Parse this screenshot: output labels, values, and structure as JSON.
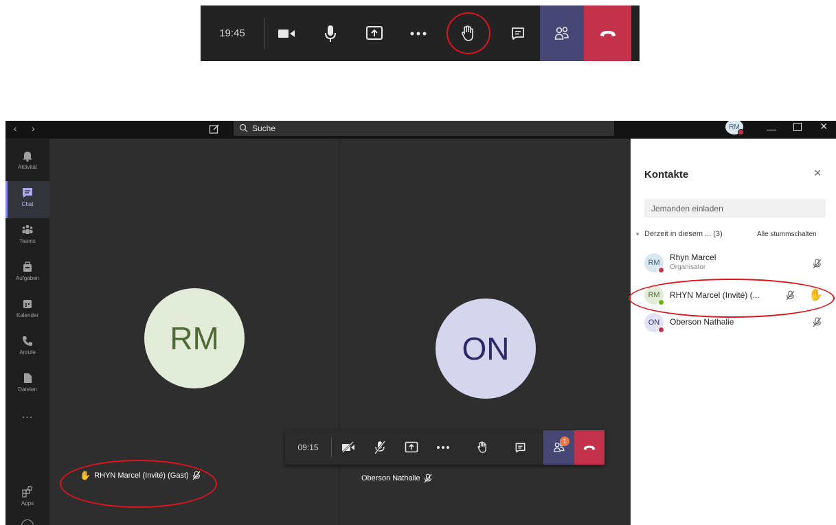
{
  "top_toolbar": {
    "time": "19:45",
    "buttons": [
      "camera-icon",
      "microphone-icon",
      "share-screen-icon",
      "more-options-icon",
      "raise-hand-icon",
      "chat-icon",
      "participants-icon",
      "hang-up-icon"
    ]
  },
  "titlebar": {
    "search_placeholder": "Suche",
    "avatar": "RM"
  },
  "rail": {
    "items": [
      {
        "label": "Aktivität"
      },
      {
        "label": "Chat"
      },
      {
        "label": "Teams"
      },
      {
        "label": "Aufgaben"
      },
      {
        "label": "Kalender"
      },
      {
        "label": "Anrufe"
      },
      {
        "label": "Dateien"
      },
      {
        "label": "Apps"
      }
    ],
    "more": "..."
  },
  "tiles": [
    {
      "initials": "RM",
      "name": "RHYN Marcel (Invité) (Gast)",
      "bg": "#e3ecd9",
      "fg": "#4f6b35"
    },
    {
      "initials": "ON",
      "name": "Oberson Nathalie",
      "bg": "#d6d5ee",
      "fg": "#2b2a66"
    }
  ],
  "meeting_toolbar": {
    "time": "09:15",
    "participants_badge": "1"
  },
  "panel": {
    "title": "Kontakte",
    "invite_placeholder": "Jemanden einladen",
    "section_label": "Derzeit in diesem ... (3)",
    "mute_all": "Alle stummschalten",
    "participants": [
      {
        "initials": "RM",
        "name": "Rhyn Marcel",
        "role": "Organisator",
        "av_bg": "#d9e8ee",
        "status": "#c4314b"
      },
      {
        "initials": "RM",
        "name": "RHYN Marcel (Invité) (...",
        "role": "",
        "av_bg": "#e3ecd9",
        "status": "#6bb700"
      },
      {
        "initials": "ON",
        "name": "Oberson Nathalie",
        "role": "",
        "av_bg": "#e3e2f3",
        "status": "#c4314b"
      }
    ]
  },
  "colors": {
    "hangup": "#c4314b",
    "participants_active": "#464775",
    "accent": "#7f85f5",
    "raise_hand": "#f8d22a",
    "annotation": "#e0141d"
  }
}
